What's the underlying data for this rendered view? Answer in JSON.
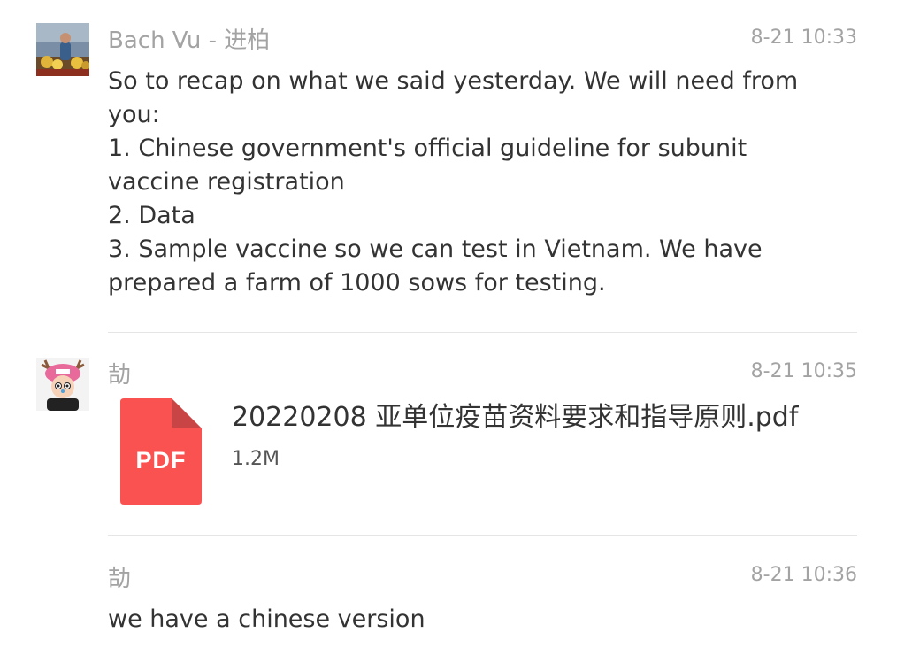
{
  "colors": {
    "meta_text": "#a3a3a3",
    "body_text": "#333333",
    "divider": "#e5e5e5",
    "pdf_red": "#fa5151",
    "pdf_fold": "#c94444"
  },
  "messages": [
    {
      "sender": "Bach Vu - 进柏",
      "time": "8-21 10:33",
      "avatar_icon": "user-photo-avatar",
      "lines": [
        "So to recap on what we said yesterday. We will need from",
        "you:",
        "1. Chinese government's official guideline for subunit",
        "vaccine registration",
        "2. Data",
        "3. Sample vaccine so we can test in Vietnam. We have",
        "prepared a farm of 1000 sows for testing."
      ]
    },
    {
      "sender": "劼",
      "time": "8-21 10:35",
      "avatar_icon": "cartoon-character-avatar",
      "file": {
        "icon": "pdf-file-icon",
        "icon_label": "PDF",
        "name": "20220208 亚单位疫苗资料要求和指导原则.pdf",
        "size": "1.2M"
      }
    },
    {
      "sender": "劼",
      "time": "8-21 10:36",
      "text": "we have a chinese version"
    }
  ]
}
